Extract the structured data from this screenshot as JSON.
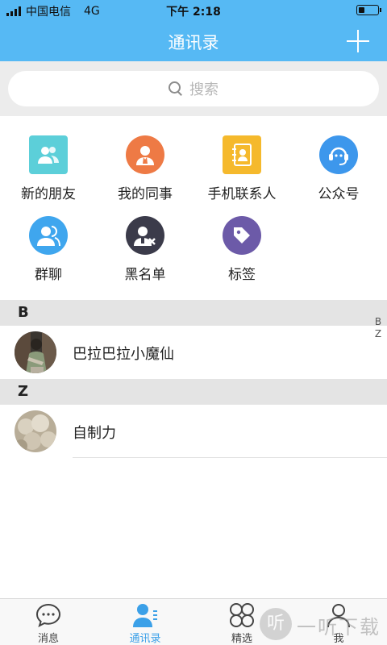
{
  "status_bar": {
    "carrier": "中国电信",
    "network": "4G",
    "time": "下午 2:18",
    "battery_level": 0.3
  },
  "nav": {
    "title": "通讯录",
    "add_icon": "plus-icon"
  },
  "search": {
    "placeholder": "搜索",
    "icon": "search-icon"
  },
  "quick_actions": [
    {
      "label": "新的朋友",
      "icon": "new-friends-icon",
      "color": "#5ccfd9"
    },
    {
      "label": "我的同事",
      "icon": "colleagues-icon",
      "color": "#ee7a45"
    },
    {
      "label": "手机联系人",
      "icon": "phone-contacts-icon",
      "color": "#f5b92c"
    },
    {
      "label": "公众号",
      "icon": "official-account-icon",
      "color": "#3d97ec"
    },
    {
      "label": "群聊",
      "icon": "group-chat-icon",
      "color": "#3fa6ee"
    },
    {
      "label": "黑名单",
      "icon": "blacklist-icon",
      "color": "#3b3b4a"
    },
    {
      "label": "标签",
      "icon": "tag-icon",
      "color": "#6c5aa8"
    }
  ],
  "sections": [
    {
      "letter": "B",
      "contacts": [
        {
          "name": "巴拉巴拉小魔仙"
        }
      ]
    },
    {
      "letter": "Z",
      "contacts": [
        {
          "name": "自制力"
        }
      ]
    }
  ],
  "index_letters": [
    "B",
    "Z"
  ],
  "tabs": [
    {
      "label": "消息",
      "icon": "chat-bubble-icon",
      "active": false
    },
    {
      "label": "通讯录",
      "icon": "contacts-icon",
      "active": true
    },
    {
      "label": "精选",
      "icon": "featured-icon",
      "active": false
    },
    {
      "label": "我",
      "icon": "profile-icon",
      "active": false
    }
  ],
  "watermark": {
    "glyph": "听",
    "text": "一听下载"
  },
  "colors": {
    "primary": "#56b9f4",
    "active_tab": "#3ba0e8",
    "section_bg": "#e4e4e4"
  }
}
